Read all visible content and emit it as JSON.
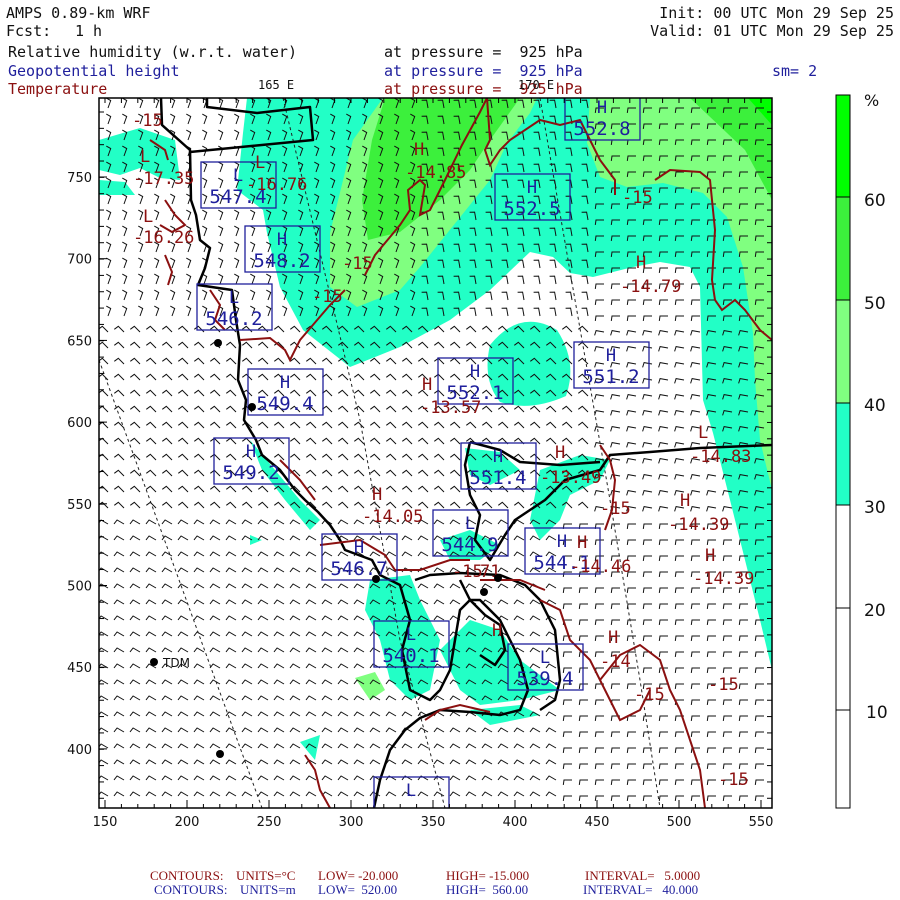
{
  "header": {
    "model": "AMPS 0.89-km WRF",
    "fcst_label": "Fcst:",
    "fcst_value": "1 h",
    "init": "Init: 00 UTC Mon 29 Sep 25",
    "valid": "Valid: 01 UTC Mon 29 Sep 25"
  },
  "fields": [
    {
      "name": "Relative humidity (w.r.t. water)",
      "level": "at pressure =  925 hPa"
    },
    {
      "name": "Geopotential height",
      "level": "at pressure =  925 hPa"
    },
    {
      "name": "Temperature",
      "level": "at pressure =  925 hPa"
    }
  ],
  "smoothing": "sm= 2",
  "longitude_labels": [
    "165 E",
    "170 E"
  ],
  "axes": {
    "x_ticks": [
      "150",
      "200",
      "250",
      "300",
      "350",
      "400",
      "450",
      "500",
      "550"
    ],
    "y_ticks": [
      "750",
      "700",
      "650",
      "600",
      "550",
      "500",
      "450",
      "400"
    ]
  },
  "colorbar": {
    "unit": "%",
    "ticks": [
      "60",
      "50",
      "40",
      "30",
      "20",
      "10"
    ],
    "colors": {
      "60_70": "#00ff00",
      "50_60": "#3cf03c",
      "40_50": "#80ff80",
      "30_40": "#22ffc6",
      "below_30": "#ffffff"
    }
  },
  "station": "TDM",
  "colors": {
    "height": "#1f1f9c",
    "temperature": "#8b1010",
    "coast": "#000000"
  },
  "height_centers": [
    {
      "type": "L",
      "value": "547.4"
    },
    {
      "type": "H",
      "value": "548.2"
    },
    {
      "type": "L",
      "value": "546.2"
    },
    {
      "type": "H",
      "value": "549.4"
    },
    {
      "type": "H",
      "value": "549.2"
    },
    {
      "type": "H",
      "value": "552.8"
    },
    {
      "type": "H",
      "value": "552.5"
    },
    {
      "type": "H",
      "value": "552.1"
    },
    {
      "type": "H",
      "value": "551.2"
    },
    {
      "type": "H",
      "value": "551.4"
    },
    {
      "type": "L",
      "value": "544.9"
    },
    {
      "type": "H",
      "value": "546.7"
    },
    {
      "type": "H",
      "value": "544.1"
    },
    {
      "type": "L",
      "value": "540.1"
    },
    {
      "type": "L",
      "value": "539.4"
    },
    {
      "type": "L",
      "value": ""
    }
  ],
  "temperature_labels": [
    "-15",
    "L",
    "-17.35",
    "L",
    "-16.26",
    "L",
    "-16.76",
    "H",
    "-14.85",
    "-15",
    "-15",
    "H",
    "-13.57",
    "-15",
    "H",
    "-14.79",
    "L",
    "-14.83",
    "H",
    "-14.39",
    "H",
    "-14.39",
    "H",
    "-13.49",
    "-15",
    "H",
    "-14.05",
    "H",
    "-14.46",
    "-15",
    "71",
    "H",
    "H",
    "-14",
    "-15",
    "-15",
    "-15"
  ],
  "footer": {
    "temperature": {
      "label": "CONTOURS:",
      "units": "UNITS=°C",
      "low": "LOW= -20.000",
      "high": "HIGH= -15.000",
      "interval": "INTERVAL=   5.0000"
    },
    "height": {
      "label": "CONTOURS:",
      "units": "UNITS=m",
      "low": "LOW=  520.00",
      "high": "HIGH=  560.00",
      "interval": "INTERVAL=   40.000"
    }
  }
}
